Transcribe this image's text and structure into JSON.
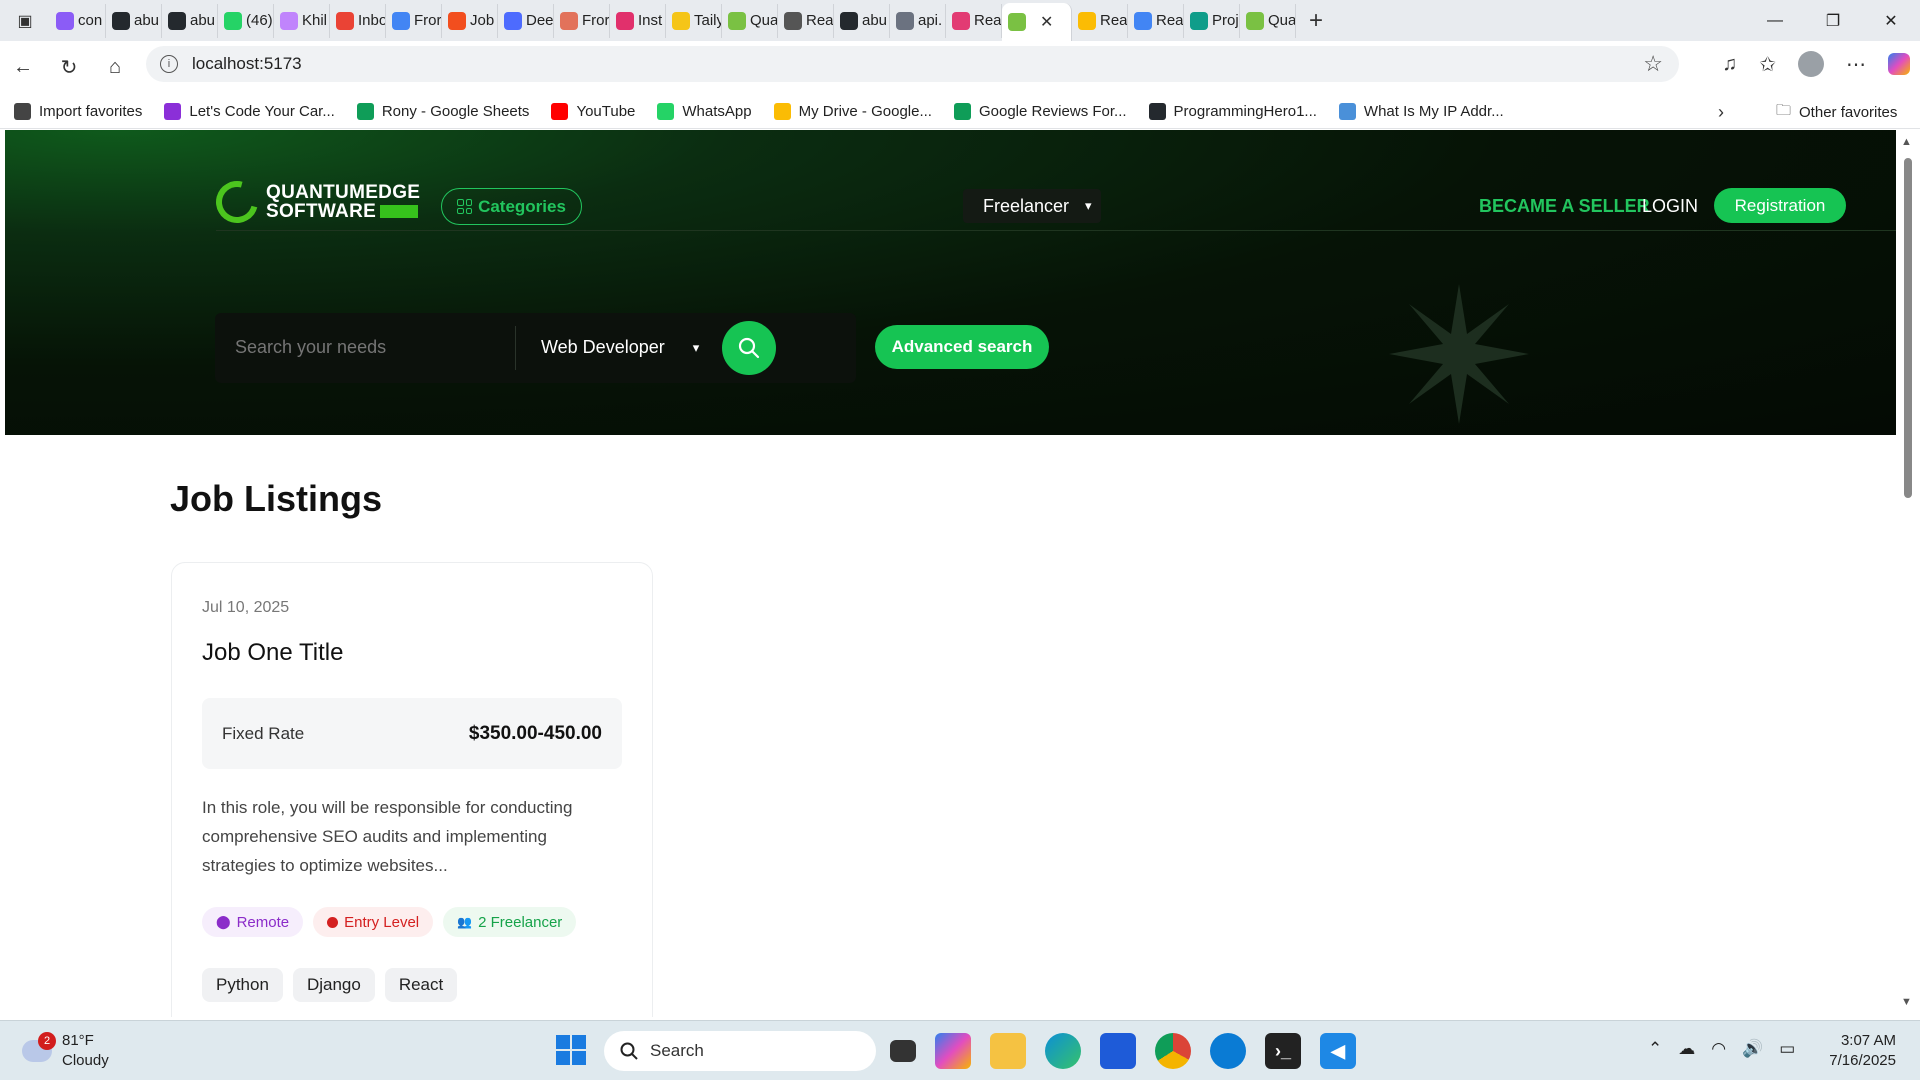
{
  "browser": {
    "tabs": [
      {
        "label": "con",
        "color": "#8b5cf6"
      },
      {
        "label": "abu",
        "color": "#24292e"
      },
      {
        "label": "abu",
        "color": "#24292e"
      },
      {
        "label": "(46)",
        "color": "#25d366"
      },
      {
        "label": "Khil",
        "color": "#c084fc"
      },
      {
        "label": "Inbo",
        "color": "#ea4335"
      },
      {
        "label": "Fror",
        "color": "#4285f4"
      },
      {
        "label": "Job",
        "color": "#f24e1e"
      },
      {
        "label": "Dee",
        "color": "#4d6bfe"
      },
      {
        "label": "Fror",
        "color": "#e2725b"
      },
      {
        "label": "Inst",
        "color": "#e1306c"
      },
      {
        "label": "Taily",
        "color": "#f5c518"
      },
      {
        "label": "Qua",
        "color": "#7ac143"
      },
      {
        "label": "Rea",
        "color": "#555555"
      },
      {
        "label": "abu",
        "color": "#24292e"
      },
      {
        "label": "api.",
        "color": "#6b7280"
      },
      {
        "label": "Rea",
        "color": "#e23b73"
      },
      {
        "label": "",
        "color": "#7ac143",
        "active": true
      },
      {
        "label": "Rea",
        "color": "#fbbc04"
      },
      {
        "label": "Rea",
        "color": "#4285f4"
      },
      {
        "label": "Proj",
        "color": "#0f9d8a"
      },
      {
        "label": "Qua",
        "color": "#7ac143"
      }
    ],
    "url": "localhost:5173",
    "bookmarks": [
      {
        "label": "Import favorites",
        "color": "#444444"
      },
      {
        "label": "Let's Code Your Car...",
        "color": "#8b2fd8"
      },
      {
        "label": "Rony - Google Sheets",
        "color": "#0f9d58"
      },
      {
        "label": "YouTube",
        "color": "#ff0000"
      },
      {
        "label": "WhatsApp",
        "color": "#25d366"
      },
      {
        "label": "My Drive - Google...",
        "color": "#fbbc04"
      },
      {
        "label": "Google Reviews For...",
        "color": "#0f9d58"
      },
      {
        "label": "ProgrammingHero1...",
        "color": "#24292e"
      },
      {
        "label": "What Is My IP Addr...",
        "color": "#4a90d9"
      }
    ],
    "other_favorites": "Other favorites"
  },
  "site": {
    "logo_line1": "QUANTUMEDGE",
    "logo_line2": "SOFTWARE",
    "categories": "Categories",
    "freelancer": "Freelancer",
    "became_seller": "BECAME A SELLER",
    "login": "LOGIN",
    "registration": "Registration",
    "search_placeholder": "Search your needs",
    "role": "Web Developer",
    "advanced_search": "Advanced search",
    "accent": "#16c453"
  },
  "listings": {
    "title": "Job Listings",
    "jobs": [
      {
        "date": "Jul 10, 2025",
        "title": "Job One Title",
        "rate_label": "Fixed Rate",
        "rate_value": "$350.00-450.00",
        "description": "In this role, you will be responsible for conducting comprehensive SEO audits and implementing strategies to optimize websites...",
        "badges": [
          "Remote",
          "Entry Level",
          "2 Freelancer"
        ],
        "skills": [
          "Python",
          "Django",
          "React"
        ]
      }
    ]
  },
  "taskbar": {
    "weather_temp": "81°F",
    "weather_desc": "Cloudy",
    "weather_badge": "2",
    "search": "Search",
    "time": "3:07 AM",
    "date": "7/16/2025"
  }
}
